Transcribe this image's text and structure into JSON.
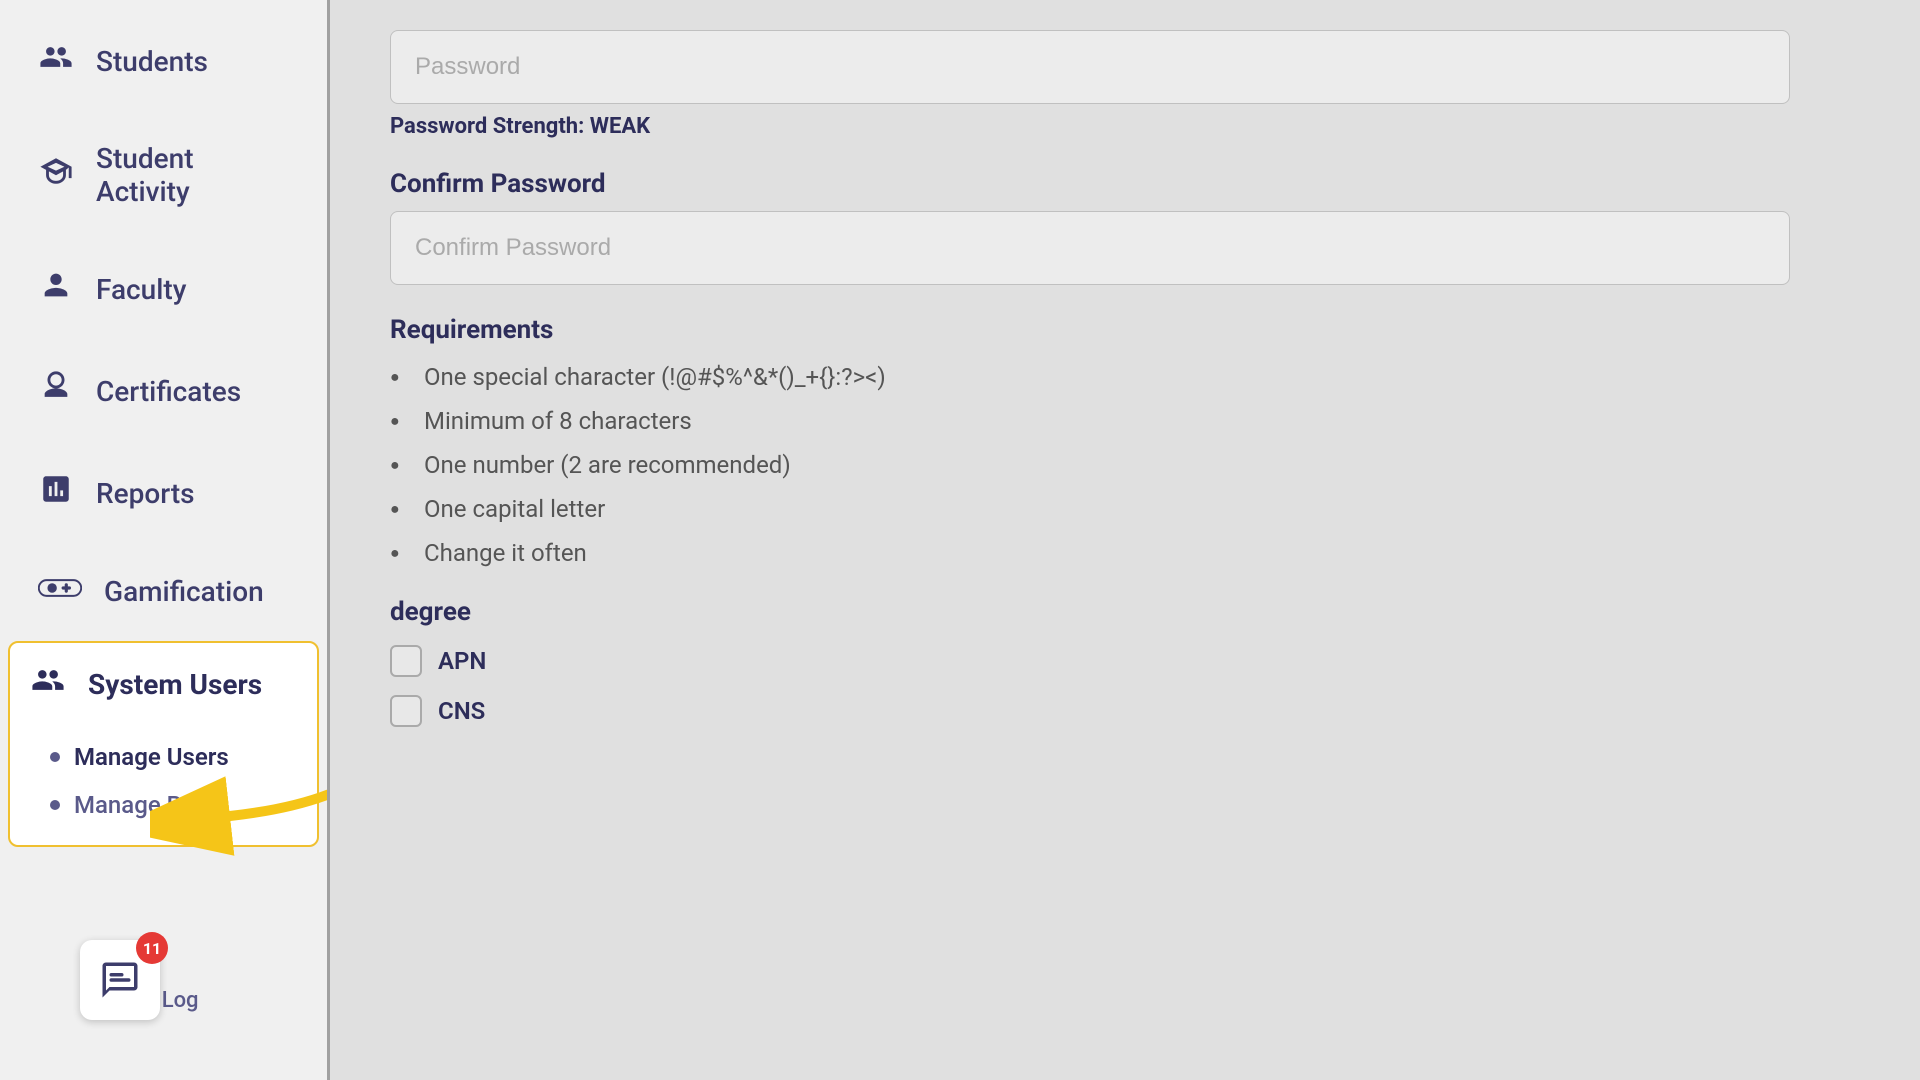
{
  "sidebar": {
    "items": [
      {
        "id": "students",
        "label": "Students",
        "icon": "👥"
      },
      {
        "id": "student-activity",
        "label": "Student Activity",
        "icon": "🎓"
      },
      {
        "id": "faculty",
        "label": "Faculty",
        "icon": "👤"
      },
      {
        "id": "certificates",
        "label": "Certificates",
        "icon": "🔧"
      },
      {
        "id": "reports",
        "label": "Reports",
        "icon": "📊"
      },
      {
        "id": "gamification",
        "label": "Gamification",
        "icon": "🎮"
      },
      {
        "id": "system-users",
        "label": "System Users",
        "icon": "👥",
        "active": true,
        "subItems": [
          {
            "id": "manage-users",
            "label": "Manage Users",
            "active": true
          },
          {
            "id": "manage-roles",
            "label": "Manage Roles",
            "active": false
          }
        ]
      }
    ],
    "chatWidget": {
      "badge": "11",
      "activityLogLabel": "ivity Log"
    }
  },
  "form": {
    "passwordField": {
      "placeholder": "Password",
      "label": ""
    },
    "passwordStrength": {
      "label": "Password Strength: WEAK"
    },
    "confirmPasswordField": {
      "label": "Confirm Password",
      "placeholder": "Confirm Password"
    },
    "requirements": {
      "title": "Requirements",
      "items": [
        "One special character (!@#$%^&*()_+{}:?><)",
        "Minimum of 8 characters",
        "One number (2 are recommended)",
        "One capital letter",
        "Change it often"
      ]
    },
    "degree": {
      "title": "degree",
      "options": [
        {
          "id": "apn",
          "label": "APN"
        },
        {
          "id": "cns",
          "label": "CNS"
        }
      ]
    }
  },
  "arrow": {
    "label": "Manage Users arrow annotation"
  }
}
